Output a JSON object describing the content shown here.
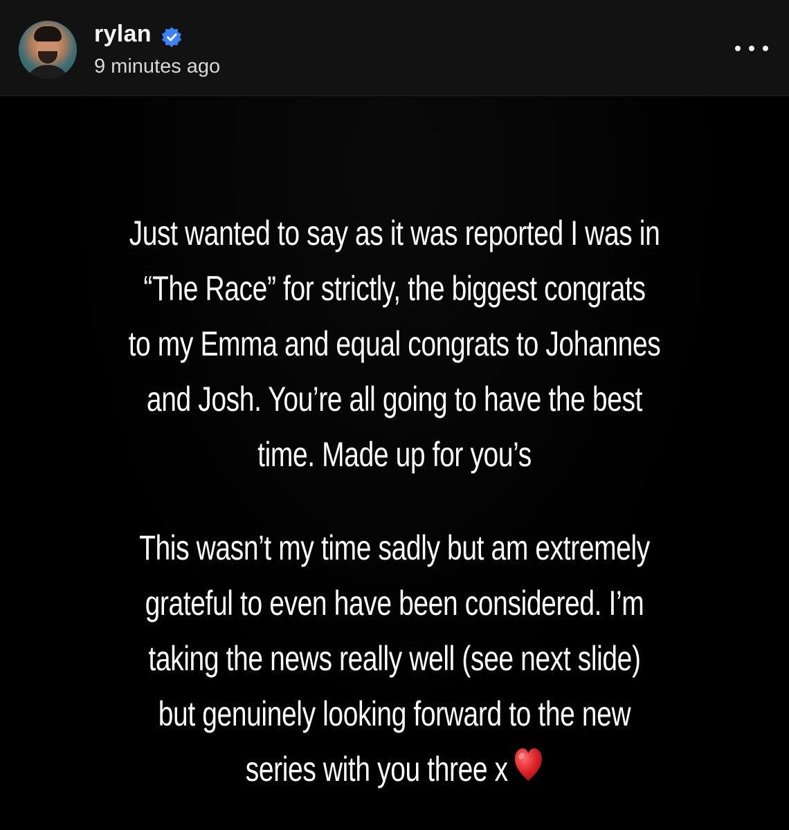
{
  "header": {
    "username": "rylan",
    "timestamp": "9 minutes ago",
    "verified_color": "#3b82f6"
  },
  "story": {
    "paragraph1_lines": [
      "Just wanted to say as it was reported I was in",
      "“The Race” for strictly, the biggest congrats",
      "to my Emma and equal congrats to Johannes",
      "and Josh. You’re all going to have the best",
      "time. Made up for you’s"
    ],
    "paragraph2_lines": [
      "This wasn’t my time sadly but am extremely",
      "grateful to even have been considered. I’m",
      "taking the news really well (see next slide)",
      "but genuinely looking forward to the new",
      "series with you three x"
    ],
    "emoji": "heart-icon",
    "heart_color": "#e0262b"
  }
}
